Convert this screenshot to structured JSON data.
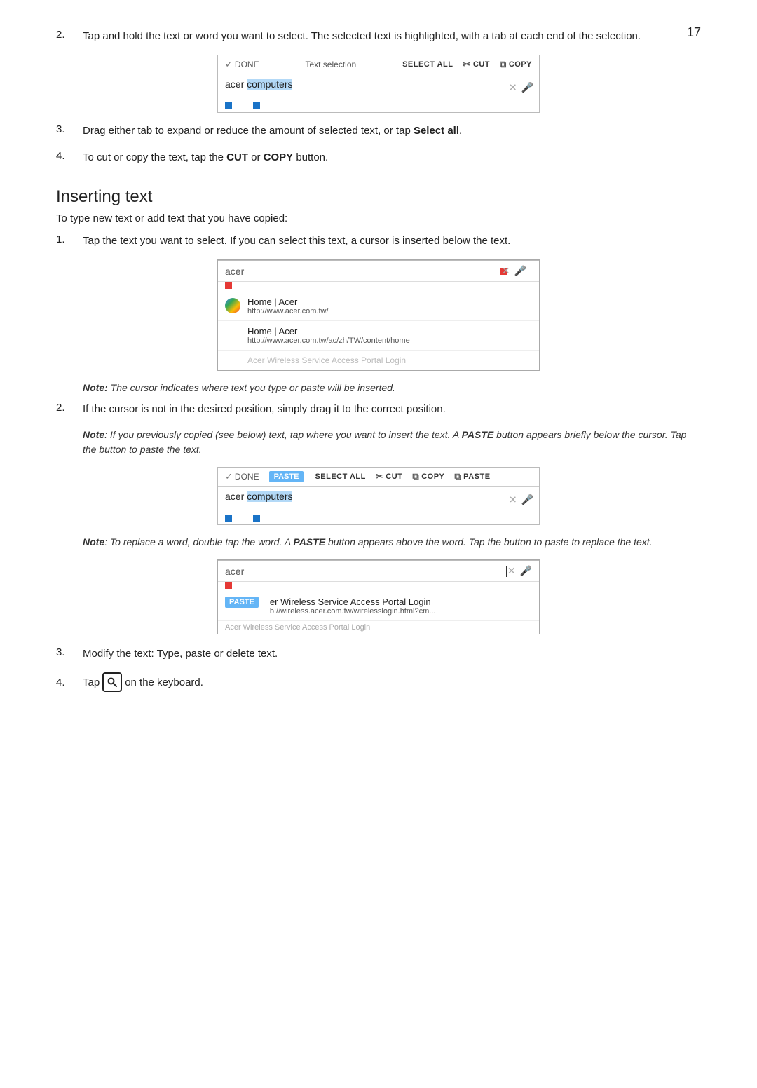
{
  "page": {
    "number": "17",
    "steps_initial": [
      {
        "num": "2.",
        "text": "Tap and hold the text or word you want to select. The selected text is highlighted, with a tab at each end of the selection."
      },
      {
        "num": "3.",
        "text": "Drag either tab to expand or reduce the amount of selected text, or tap <b>Select all</b>."
      },
      {
        "num": "4.",
        "text": "To cut or copy the text, tap the <b>CUT</b> or <b>COPY</b> button."
      }
    ],
    "screenshot1": {
      "toolbar": {
        "done_label": "DONE",
        "title": "Text selection",
        "select_all": "SELECT ALL",
        "cut_label": "CUT",
        "copy_label": "COPY"
      },
      "input": {
        "text_before": "acer ",
        "text_selected": "computers",
        "text_after": ""
      }
    },
    "section_heading": "Inserting text",
    "section_intro": "To type new text or add text that you have copied:",
    "insert_steps": [
      {
        "num": "1.",
        "text": "Tap the text you want to select. If you can select this text, a cursor is inserted below the text."
      }
    ],
    "screenshot_insert": {
      "input": {
        "text": "acer"
      },
      "suggestions": [
        {
          "type": "google",
          "title": "Home | Acer",
          "url": "http://www.acer.com.tw/"
        },
        {
          "type": "plain",
          "title": "Home | Acer",
          "url": "http://www.acer.com.tw/ac/zh/TW/content/home"
        },
        {
          "type": "faded",
          "title": "Acer Wireless Service Access Portal Login",
          "url": ""
        }
      ]
    },
    "note1": {
      "label": "Note:",
      "text": " The cursor indicates where text you type or paste will be inserted."
    },
    "insert_step2": {
      "num": "2.",
      "text": "If the cursor is not in the desired position, simply drag it to the correct position."
    },
    "note2": {
      "label": "Note",
      "text": ": If you previously copied (see below) text, tap where you want to insert the text. A "
    },
    "note2_paste": "PASTE",
    "note2_rest": " button appears briefly below the cursor. Tap the button to paste the text.",
    "screenshot_paste": {
      "toolbar": {
        "done_label": "DONE",
        "paste_btn": "PASTE",
        "select_all": "SELECT ALL",
        "cut_label": "CUT",
        "copy_label": "COPY",
        "paste_label": "PASTE"
      },
      "input": {
        "text_before": "acer ",
        "text_selected": "computers",
        "text_after": ""
      }
    },
    "note3": {
      "label": "Note",
      "text": ": To replace a word, double tap the word. A "
    },
    "note3_paste": "PASTE",
    "note3_rest": " button appears above the word. Tap the button to paste to replace the text.",
    "screenshot_replace": {
      "input": {
        "text": "acer"
      },
      "paste_suggestion": {
        "paste_btn": "PASTE",
        "title": "er Wireless Service Access Portal Login",
        "url": "b://wireless.acer.com.tw/wirelesslogin.html?cm..."
      },
      "faded": "Acer Wireless Service Access Portal Login"
    },
    "final_steps": [
      {
        "num": "3.",
        "text": "Modify the text: Type, paste or delete text."
      },
      {
        "num": "4.",
        "text_before": "Tap",
        "keyboard_icon": "🔍",
        "text_after": "on the keyboard."
      }
    ]
  }
}
